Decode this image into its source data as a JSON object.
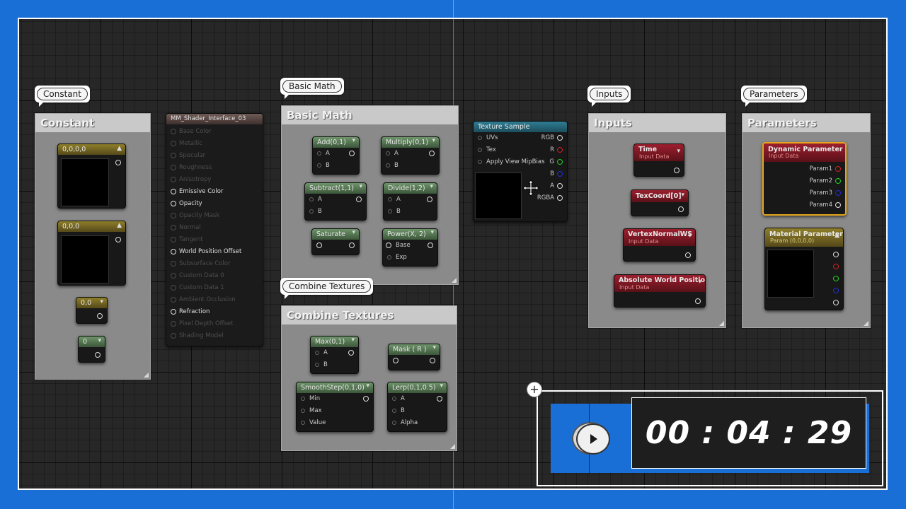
{
  "comments": {
    "constant": {
      "bubble": "Constant",
      "title": "Constant"
    },
    "basic_math": {
      "bubble": "Basic Math",
      "title": "Basic Math"
    },
    "combine_textures": {
      "bubble": "Combine Textures",
      "title": "Combine Textures"
    },
    "inputs": {
      "bubble": "Inputs",
      "title": "Inputs"
    },
    "parameters": {
      "bubble": "Parameters",
      "title": "Parameters"
    }
  },
  "constant_nodes": {
    "vec4": "0,0,0,0",
    "vec3": "0,0,0",
    "vec2": "0,0",
    "scalar": "0"
  },
  "material_output": {
    "title": "MM_Shader_Interface_03",
    "pins": [
      {
        "label": "Base Color",
        "active": false
      },
      {
        "label": "Metallic",
        "active": false
      },
      {
        "label": "Specular",
        "active": false
      },
      {
        "label": "Roughness",
        "active": false
      },
      {
        "label": "Anisotropy",
        "active": false
      },
      {
        "label": "Emissive Color",
        "active": true
      },
      {
        "label": "Opacity",
        "active": true
      },
      {
        "label": "Opacity Mask",
        "active": false
      },
      {
        "label": "Normal",
        "active": false
      },
      {
        "label": "Tangent",
        "active": false
      },
      {
        "label": "World Position Offset",
        "active": true
      },
      {
        "label": "Subsurface Color",
        "active": false
      },
      {
        "label": "Custom Data 0",
        "active": false
      },
      {
        "label": "Custom Data 1",
        "active": false
      },
      {
        "label": "Ambient Occlusion",
        "active": false
      },
      {
        "label": "Refraction",
        "active": true
      },
      {
        "label": "Pixel Depth Offset",
        "active": false
      },
      {
        "label": "Shading Model",
        "active": false
      }
    ]
  },
  "math_nodes": {
    "add": {
      "title": "Add(0,1)",
      "a": "A",
      "b": "B"
    },
    "multiply": {
      "title": "Multiply(0,1)",
      "a": "A",
      "b": "B"
    },
    "subtract": {
      "title": "Subtract(1,1)",
      "a": "A",
      "b": "B"
    },
    "divide": {
      "title": "Divide(1,2)",
      "a": "A",
      "b": "B"
    },
    "saturate": {
      "title": "Saturate"
    },
    "power": {
      "title": "Power(X, 2)",
      "a": "Base",
      "b": "Exp"
    }
  },
  "combine_nodes": {
    "max": {
      "title": "Max(0,1)",
      "a": "A",
      "b": "B"
    },
    "mask": {
      "title": "Mask ( R )"
    },
    "smoothstep": {
      "title": "SmoothStep(0,1,0)",
      "a": "Min",
      "b": "Max",
      "c": "Value"
    },
    "lerp": {
      "title": "Lerp(0,1,0.5)",
      "a": "A",
      "b": "B",
      "c": "Alpha"
    }
  },
  "texture_sample": {
    "title": "Texture Sample",
    "inputs": [
      "UVs",
      "Tex",
      "Apply View MipBias"
    ],
    "outputs": [
      "RGB",
      "R",
      "G",
      "B",
      "A",
      "RGBA"
    ],
    "pin_colors": [
      "#dddddd",
      "#d02020",
      "#20d020",
      "#2030d0",
      "#dddddd",
      "#dddddd"
    ]
  },
  "input_nodes": {
    "time": {
      "title": "Time",
      "subtitle": "Input Data"
    },
    "texcoord": {
      "title": "TexCoord[0]"
    },
    "vertexnormal": {
      "title": "VertexNormalWS",
      "subtitle": "Input Data"
    },
    "absworldpos": {
      "title": "Absolute World Position",
      "subtitle": "Input Data"
    }
  },
  "param_nodes": {
    "dynamic": {
      "title": "Dynamic Parameter",
      "subtitle": "Input Data",
      "params": [
        "Param1",
        "Param2",
        "Param3",
        "Param4"
      ],
      "param_colors": [
        "#d02020",
        "#20d020",
        "#2030d0",
        "#dddddd"
      ]
    },
    "material": {
      "title": "Material Parameter",
      "subtitle": "Param (0,0,0,0)",
      "pin_colors": [
        "#dddddd",
        "#d02020",
        "#20d020",
        "#2030d0",
        "#dddddd"
      ]
    }
  },
  "timer": {
    "time": "00 : 04 : 29",
    "plus": "+"
  },
  "icons": {
    "play": "play-icon",
    "move": "move-cursor-icon",
    "plus": "plus-icon"
  },
  "colors": {
    "frame_blue": "#1a6fd6",
    "selection_outline": "#e4a41c"
  }
}
